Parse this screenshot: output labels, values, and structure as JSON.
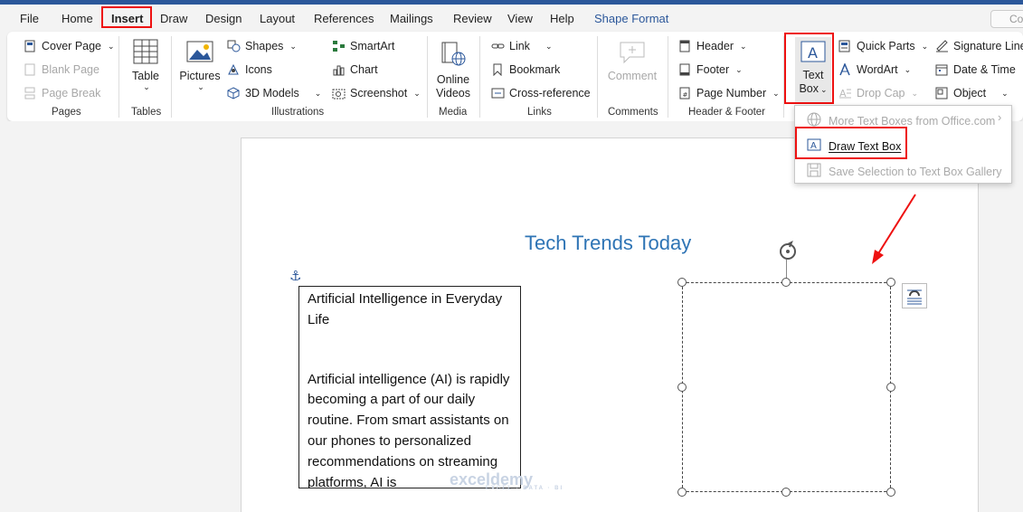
{
  "menu": {
    "tabs": [
      {
        "label": "File"
      },
      {
        "label": "Home"
      },
      {
        "label": "Insert"
      },
      {
        "label": "Draw"
      },
      {
        "label": "Design"
      },
      {
        "label": "Layout"
      },
      {
        "label": "References"
      },
      {
        "label": "Mailings"
      },
      {
        "label": "Review"
      },
      {
        "label": "View"
      },
      {
        "label": "Help"
      },
      {
        "label": "Shape Format"
      }
    ],
    "comments_partial": "Co"
  },
  "ribbon": {
    "pages": {
      "label": "Pages",
      "cover_page": "Cover Page",
      "blank_page": "Blank Page",
      "page_break": "Page Break"
    },
    "tables": {
      "label": "Tables",
      "table": "Table"
    },
    "illustrations": {
      "label": "Illustrations",
      "pictures": "Pictures",
      "shapes": "Shapes",
      "icons": "Icons",
      "models": "3D Models",
      "smartart": "SmartArt",
      "chart": "Chart",
      "screenshot": "Screenshot"
    },
    "media": {
      "label": "Media",
      "online_videos_1": "Online",
      "online_videos_2": "Videos"
    },
    "links": {
      "label": "Links",
      "link": "Link",
      "bookmark": "Bookmark",
      "cross_reference": "Cross-reference"
    },
    "comments": {
      "label": "Comments",
      "comment": "Comment"
    },
    "header_footer": {
      "label": "Header & Footer",
      "header": "Header",
      "footer": "Footer",
      "page_number": "Page Number"
    },
    "text": {
      "text_box_1": "Text",
      "text_box_2": "Box",
      "quick_parts": "Quick Parts",
      "wordart": "WordArt",
      "drop_cap": "Drop Cap",
      "signature_line": "Signature Line",
      "date_time": "Date & Time",
      "object": "Object"
    }
  },
  "dropdown": {
    "more_text_boxes": "More Text Boxes from Office.com",
    "draw_text_box": "Draw Text Box",
    "save_selection": "Save Selection to Text Box Gallery"
  },
  "document": {
    "title": "Tech Trends Today",
    "textbox_heading": "Artificial Intelligence in Everyday Life",
    "textbox_body": "Artificial intelligence (AI) is rapidly becoming a part of our daily routine. From smart assistants on our phones to personalized recommendations on streaming platforms, AI is"
  },
  "watermark": {
    "name": "exceldemy",
    "tagline": "EXCEL · DATA · BI"
  },
  "colors": {
    "accent": "#2b579a",
    "title": "#2e74b5",
    "highlight": "#e11111"
  }
}
